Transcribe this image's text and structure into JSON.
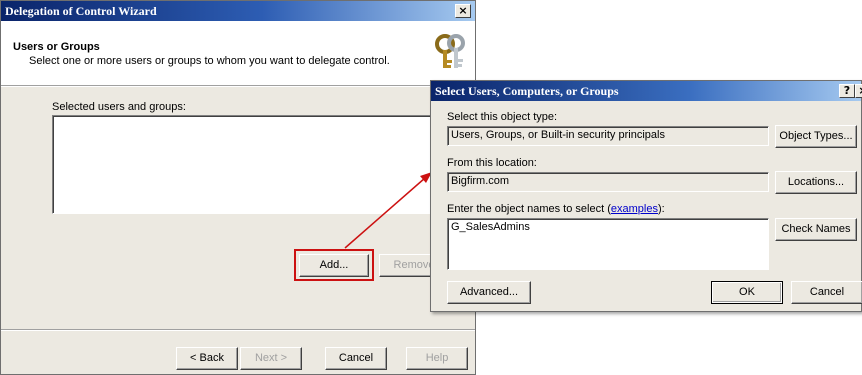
{
  "wizard": {
    "title": "Delegation of Control Wizard",
    "close_glyph": "×",
    "header_title": "Users or Groups",
    "header_desc": "Select one or more users or groups to whom you want to delegate control.",
    "icon": "keys-icon",
    "list_label": "Selected users and groups:",
    "add_label": "Add...",
    "remove_label": "Remove",
    "back_label": "< Back",
    "next_label": "Next >",
    "cancel_label": "Cancel",
    "help_label": "Help"
  },
  "select_dialog": {
    "title": "Select Users, Computers, or Groups",
    "help_glyph": "?",
    "close_glyph": "×",
    "object_type_label": "Select this object type:",
    "object_type_value": "Users, Groups, or Built-in security principals",
    "object_types_button": "Object Types...",
    "location_label": "From this location:",
    "location_value": "Bigfirm.com",
    "locations_button": "Locations...",
    "names_label_prefix": "Enter the object names to select (",
    "names_label_link": "examples",
    "names_label_suffix": "):",
    "names_value": "G_SalesAdmins",
    "check_names_button": "Check Names",
    "advanced_button": "Advanced...",
    "ok_button": "OK",
    "cancel_button": "Cancel"
  },
  "colors": {
    "title_bar": "#0a246a",
    "highlight": "#cc1111",
    "annotation_arrow": "#cc1111"
  }
}
